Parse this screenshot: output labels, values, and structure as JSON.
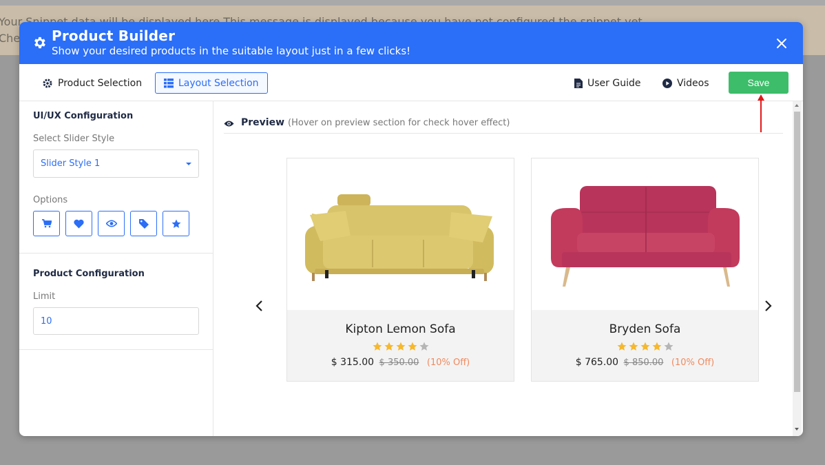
{
  "background": {
    "notice_line1": "Your Snippet data will be displayed here This message is displayed because you have not configured the snippet yet.",
    "notice_line2": "Check"
  },
  "header": {
    "title": "Product Builder",
    "subtitle": "Show your desired products in the suitable layout just in a few clicks!",
    "color": "#2b6ef7"
  },
  "toolbar": {
    "product_selection": "Product Selection",
    "layout_selection": "Layout Selection",
    "user_guide": "User Guide",
    "videos": "Videos",
    "save": "Save",
    "save_color": "#3dbd6a"
  },
  "sidebar": {
    "uiux_title": "UI/UX Configuration",
    "slider_style_label": "Select Slider Style",
    "slider_style_value": "Slider Style 1",
    "options_label": "Options",
    "options": [
      "cart-icon",
      "heart-icon",
      "eye-icon",
      "tag-icon",
      "star-icon"
    ],
    "product_config_title": "Product Configuration",
    "limit_label": "Limit",
    "limit_value": "10"
  },
  "preview": {
    "title": "Preview",
    "note": "(Hover on preview section for check hover effect)",
    "products": [
      {
        "name": "Kipton Lemon Sofa",
        "rating": 4,
        "max_rating": 5,
        "price": "$ 315.00",
        "old_price": "$ 350.00",
        "discount": "(10% Off)",
        "color": "#d8c46a"
      },
      {
        "name": "Bryden Sofa",
        "rating": 4,
        "max_rating": 5,
        "price": "$ 765.00",
        "old_price": "$ 850.00",
        "discount": "(10% Off)",
        "color": "#c23a5c"
      }
    ]
  }
}
